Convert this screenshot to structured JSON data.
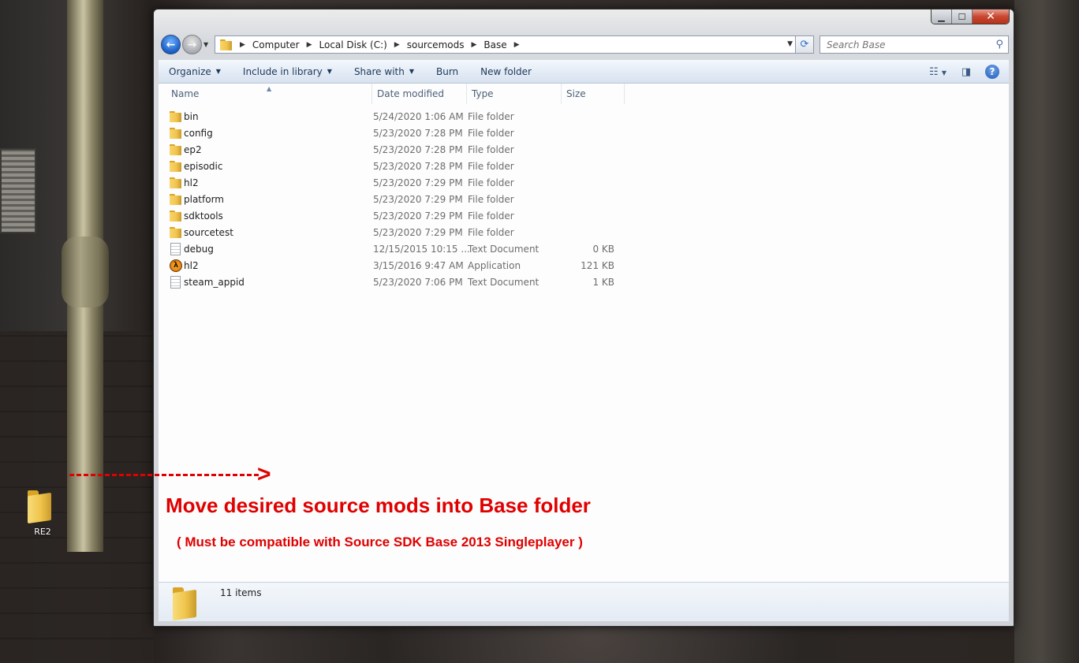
{
  "desktop": {
    "icon_label": "RE2"
  },
  "window": {
    "caption": {
      "minimize": "▁",
      "maximize": "☐",
      "close": "✕"
    },
    "address": {
      "crumbs": [
        "Computer",
        "Local Disk (C:)",
        "sourcemods",
        "Base"
      ]
    },
    "search": {
      "placeholder": "Search Base"
    },
    "toolbar": {
      "organize": "Organize",
      "include_in_library": "Include in library",
      "share_with": "Share with",
      "burn": "Burn",
      "new_folder": "New folder"
    },
    "columns": {
      "name": "Name",
      "date_modified": "Date modified",
      "type": "Type",
      "size": "Size"
    },
    "files": [
      {
        "icon": "folder-icon",
        "name": "bin",
        "date": "5/24/2020 1:06 AM",
        "type": "File folder",
        "size": ""
      },
      {
        "icon": "folder-icon",
        "name": "config",
        "date": "5/23/2020 7:28 PM",
        "type": "File folder",
        "size": ""
      },
      {
        "icon": "folder-icon",
        "name": "ep2",
        "date": "5/23/2020 7:28 PM",
        "type": "File folder",
        "size": ""
      },
      {
        "icon": "folder-icon",
        "name": "episodic",
        "date": "5/23/2020 7:28 PM",
        "type": "File folder",
        "size": ""
      },
      {
        "icon": "folder-icon",
        "name": "hl2",
        "date": "5/23/2020 7:29 PM",
        "type": "File folder",
        "size": ""
      },
      {
        "icon": "folder-icon",
        "name": "platform",
        "date": "5/23/2020 7:29 PM",
        "type": "File folder",
        "size": ""
      },
      {
        "icon": "folder-icon",
        "name": "sdktools",
        "date": "5/23/2020 7:29 PM",
        "type": "File folder",
        "size": ""
      },
      {
        "icon": "folder-icon",
        "name": "sourcetest",
        "date": "5/23/2020 7:29 PM",
        "type": "File folder",
        "size": ""
      },
      {
        "icon": "text-document-icon",
        "name": "debug",
        "date": "12/15/2015 10:15 ...",
        "type": "Text Document",
        "size": "0 KB"
      },
      {
        "icon": "application-icon",
        "name": "hl2",
        "date": "3/15/2016 9:47 AM",
        "type": "Application",
        "size": "121 KB"
      },
      {
        "icon": "text-document-icon",
        "name": "steam_appid",
        "date": "5/23/2020 7:06 PM",
        "type": "Text Document",
        "size": "1 KB"
      }
    ],
    "details": {
      "count": "11 items"
    }
  },
  "annotation": {
    "arrow_head": ">",
    "main": "Move desired source mods into Base folder",
    "sub": "( Must be compatible with Source SDK Base 2013 Singleplayer )",
    "color": "#e00000"
  }
}
